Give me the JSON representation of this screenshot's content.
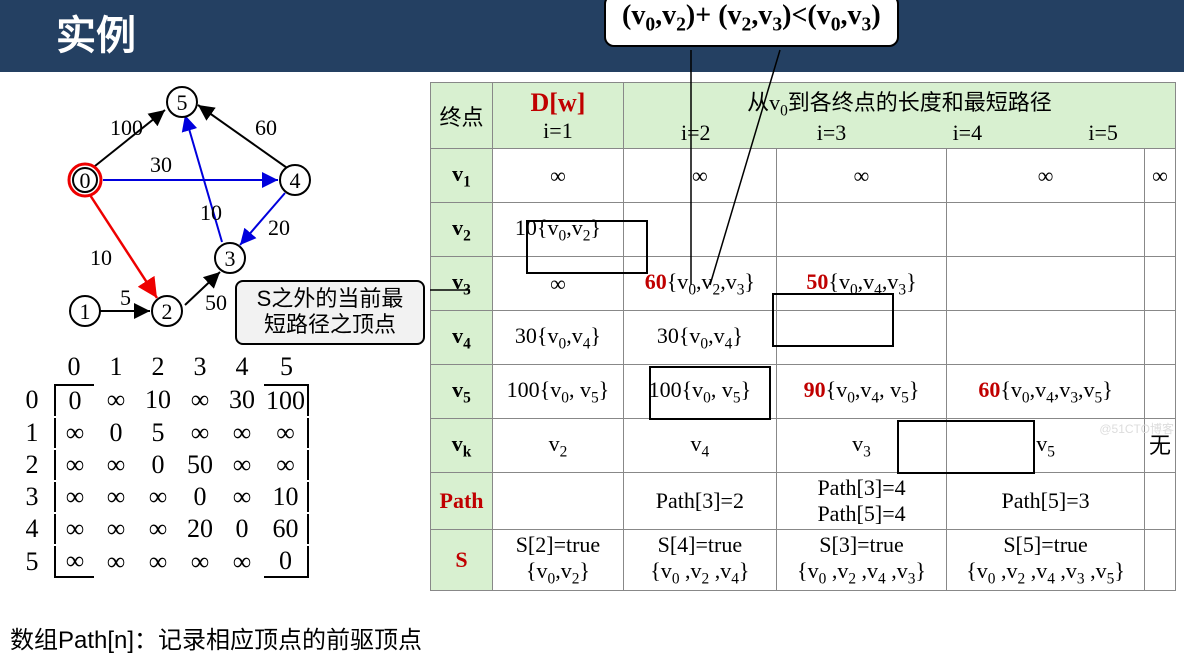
{
  "title": "实例",
  "formula": "(v₀,v₂)+ (v₂,v₃)<(v₀,v₃)",
  "callout_s": "S之外的当前最\n短路径之顶点",
  "path_caption": "数组Path[n]：记录相应顶点的前驱顶点",
  "watermark": "@51CTO博客",
  "graph": {
    "nodes": [
      "0",
      "1",
      "2",
      "3",
      "4",
      "5"
    ],
    "edge_labels": [
      "100",
      "60",
      "30",
      "10",
      "20",
      "10",
      "5",
      "50"
    ]
  },
  "matrix": {
    "col_head": [
      "0",
      "1",
      "2",
      "3",
      "4",
      "5"
    ],
    "row_head": [
      "0",
      "1",
      "2",
      "3",
      "4",
      "5"
    ],
    "rows": [
      [
        "0",
        "∞",
        "10",
        "∞",
        "30",
        "100"
      ],
      [
        "∞",
        "0",
        "5",
        "∞",
        "∞",
        "∞"
      ],
      [
        "∞",
        "∞",
        "0",
        "50",
        "∞",
        "∞"
      ],
      [
        "∞",
        "∞",
        "∞",
        "0",
        "∞",
        "10"
      ],
      [
        "∞",
        "∞",
        "∞",
        "20",
        "0",
        "60"
      ],
      [
        "∞",
        "∞",
        "∞",
        "∞",
        "∞",
        "0"
      ]
    ]
  },
  "table": {
    "header": {
      "endpoint": "终点",
      "dw": "D[w]",
      "subtitle": "从v₀到各终点的长度和最短路径",
      "cols": [
        "i=1",
        "i=2",
        "i=3",
        "i=4",
        "i=5"
      ]
    },
    "rows": [
      {
        "label": "v₁",
        "cells": [
          "∞",
          "∞",
          "∞",
          "∞",
          "∞"
        ]
      },
      {
        "label": "v₂",
        "cells": [
          "10\n{v₀,v₂}",
          "",
          "",
          "",
          ""
        ]
      },
      {
        "label": "v₃",
        "cells": [
          "∞",
          "60\n{v₀,v₂,v₃}",
          "50\n{v₀,v₄,v₃}",
          "",
          ""
        ],
        "red": [
          false,
          true,
          true,
          false,
          false
        ]
      },
      {
        "label": "v₄",
        "cells": [
          "30\n{v₀,v₄}",
          "30\n{v₀,v₄}",
          "",
          "",
          ""
        ]
      },
      {
        "label": "v₅",
        "cells": [
          "100\n{v₀, v₅}",
          "100\n{v₀, v₅}",
          "90\n{v₀,v₄, v₅}",
          "60\n{v₀,v₄,v₃,v₅}",
          ""
        ],
        "red": [
          false,
          false,
          true,
          true,
          false
        ]
      },
      {
        "label": "vₖ",
        "cells": [
          "v₂",
          "v₄",
          "v₃",
          "v₅",
          "无"
        ]
      },
      {
        "label": "Path",
        "cells": [
          "",
          "Path[3]=2",
          "Path[3]=4\nPath[5]=4",
          "Path[5]=3",
          ""
        ],
        "labelRed": true
      },
      {
        "label": "S",
        "cells": [
          "S[2]=true\n{v₀,v₂}",
          "S[4]=true\n{v₀ ,v₂ ,v₄}",
          "S[3]=true\n{v₀ ,v₂ ,v₄ ,v₃}",
          "S[5]=true\n{v₀ ,v₂ ,v₄ ,v₃ ,v₅}",
          ""
        ],
        "labelRed": true
      }
    ]
  }
}
